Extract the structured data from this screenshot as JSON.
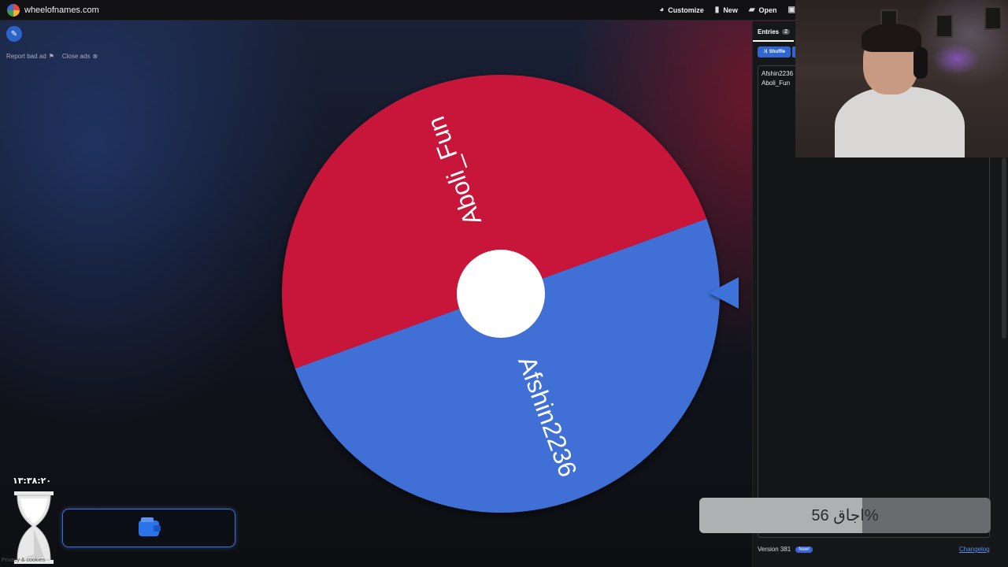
{
  "header": {
    "brand": "wheelofnames.com",
    "nav": [
      {
        "label": "Customize",
        "icon": "palette-icon"
      },
      {
        "label": "New",
        "icon": "file-icon"
      },
      {
        "label": "Open",
        "icon": "folder-icon"
      }
    ]
  },
  "ads": {
    "report_label": "Report bad ad",
    "close_label": "Close ads"
  },
  "wheel": {
    "slices": [
      {
        "label": "Aboli_Fun",
        "color": "#c8173b"
      },
      {
        "label": "Afshin2236",
        "color": "#3f6fd6"
      }
    ],
    "center_color": "#ffffff",
    "pointer_color": "#3d72d9"
  },
  "sidebar": {
    "tab_label": "Entries",
    "tab_count": "2",
    "shuffle_label": "Shuffle",
    "entries": [
      "Afshin2236",
      "Aboli_Fun"
    ],
    "version_label": "Version 381",
    "new_badge": "New!",
    "changelog_label": "Changelog"
  },
  "overlay": {
    "progress_label": "اجاق 56%",
    "progress_fraction": 0.56,
    "timer": "۱۳:۳۸:۲۰",
    "privacy": "Privacy & cookies"
  }
}
